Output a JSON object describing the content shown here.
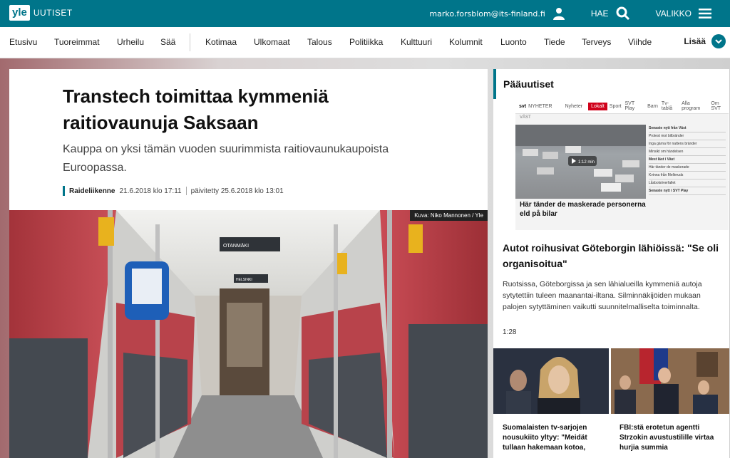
{
  "header": {
    "logo": "yle",
    "brand": "UUTISET",
    "user": "marko.forsblom@its-finland.fi",
    "search_label": "HAE",
    "menu_label": "VALIKKO"
  },
  "nav": {
    "items": [
      "Etusivu",
      "Tuoreimmat",
      "Urheilu",
      "Sää",
      "Kotimaa",
      "Ulkomaat",
      "Talous",
      "Politiikka",
      "Kulttuuri",
      "Kolumnit",
      "Luonto",
      "Tiede",
      "Terveys",
      "Viihde"
    ],
    "more": "Lisää"
  },
  "article": {
    "title": "Transtech toimittaa kymmeniä raitiovaunuja Saksaan",
    "lead": "Kauppa on yksi tämän vuoden suurimmista raitiovaunukaupoista Euroopassa.",
    "category": "Raideliikenne",
    "published": "21.6.2018 klo 17:11",
    "updated": "päivitetty 25.6.2018 klo 13:01",
    "image_credit": "Kuva: Niko Mannonen / Yle",
    "tram_signs": [
      "OTANMÄKI",
      "HELSINKI"
    ]
  },
  "sidebar": {
    "title": "Pääuutiset",
    "svt": {
      "logo": "svt",
      "brand": "NYHETER",
      "nav": [
        "Nyheter",
        "Lokalt",
        "Sport",
        "SVT Play",
        "Barn",
        "Tv-tablå",
        "Alla program",
        "Om SVT"
      ],
      "section": "VÄST",
      "video_time": "1:12 min",
      "side_items": [
        "Senaste nytt från Väst",
        "Protest mot bilbränder",
        "Inga gärna för nattens bränder",
        "Minsikt om händelsen",
        "Mest läst i Väst",
        "Här tänder de maskerade",
        "Kvinna från Melleruds",
        "Låsbolsöverfallet",
        "Senaste nytt i SVT Play"
      ],
      "headline": "Här tänder de maskerade personerna eld på bilar"
    },
    "card": {
      "title": "Autot roihusivat Göteborgin lähiöissä: \"Se oli organisoitua\"",
      "body": "Ruotsissa, Göteborgissa ja sen lähialueilla kymmeniä autoja sytytettiin tuleen maanantai-iltana. Silminnäkijöiden mukaan palojen sytyttäminen vaikutti suunnitelmalliselta toiminnalta.",
      "time": "1:28"
    },
    "small_cards": [
      {
        "title": "Suomalaisten tv-sarjojen nousukiito yltyy: \"Meidät tullaan hakemaan kotoa,"
      },
      {
        "title": "FBI:stä erotetun agentti Strzokin avustustilille virtaa hurjia summia"
      }
    ]
  },
  "colors": {
    "brand": "#00758a",
    "svt_red": "#d0021b"
  }
}
